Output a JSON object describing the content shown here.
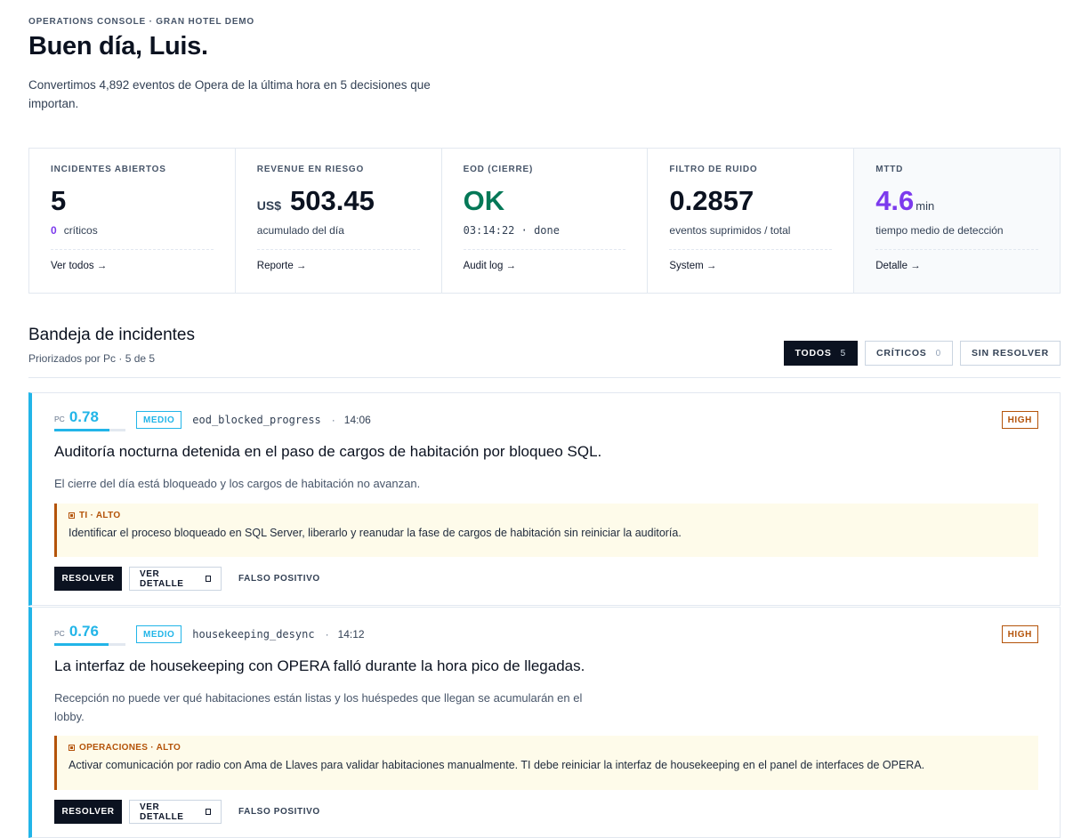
{
  "header": {
    "eyebrow": "OPERATIONS CONSOLE · GRAN HOTEL DEMO",
    "greeting": "Buen día, Luis.",
    "subtitle": "Convertimos 4,892 eventos de Opera de la última hora en 5 decisiones que importan."
  },
  "kpis": [
    {
      "label": "INCIDENTES ABIERTOS",
      "value": "5",
      "sub_prefix": "0",
      "sub": "críticos",
      "link": "Ver todos →"
    },
    {
      "label": "REVENUE EN RIESGO",
      "prefix": "US$",
      "value": "503.45",
      "sub": "acumulado del día",
      "link": "Reporte →"
    },
    {
      "label": "EOD (CIERRE)",
      "value": "OK",
      "sub": "03:14:22 · done",
      "link": "Audit log →"
    },
    {
      "label": "FILTRO DE RUIDO",
      "value": "0.2857",
      "sub": "eventos suprimidos / total",
      "link": "System →"
    },
    {
      "label": "MTTD",
      "value": "4.6",
      "unit": "min",
      "sub": "tiempo medio de detección",
      "link": "Detalle →"
    }
  ],
  "colors": {
    "accent_cyan": "#22b5e8",
    "accent_purple": "#7c3aed",
    "ok_green": "#047857",
    "high_amber": "#b45309",
    "dark": "#0b1220"
  },
  "inbox": {
    "title": "Bandeja de incidentes",
    "subtitle": "Priorizados por Pc · 5 de 5",
    "filters": [
      {
        "label": "TODOS",
        "count": "5",
        "active": true
      },
      {
        "label": "CRÍTICOS",
        "count": "0",
        "active": false
      },
      {
        "label": "SIN RESOLVER",
        "count": "",
        "active": false
      }
    ]
  },
  "incidents": [
    {
      "pc_label": "PC",
      "pc": "0.78",
      "pc_fraction": 0.78,
      "severity": "MEDIO",
      "code": "eod_blocked_progress",
      "separator": "·",
      "time": "14:06",
      "priority": "HIGH",
      "title": "Auditoría nocturna detenida en el paso de cargos de habitación por bloqueo SQL.",
      "description": "El cierre del día está bloqueado y los cargos de habitación no avanzan.",
      "action_tag": "TI · ALTO",
      "action_text": "Identificar el proceso bloqueado en SQL Server, liberarlo y reanudar la fase de cargos de habitación sin reiniciar la auditoría.",
      "btn_resolve": "RESOLVER",
      "btn_detail": "VER DETALLE",
      "btn_false": "FALSO POSITIVO"
    },
    {
      "pc_label": "PC",
      "pc": "0.76",
      "pc_fraction": 0.76,
      "severity": "MEDIO",
      "code": "housekeeping_desync",
      "separator": "·",
      "time": "14:12",
      "priority": "HIGH",
      "title": "La interfaz de housekeeping con OPERA falló durante la hora pico de llegadas.",
      "description": "Recepción no puede ver qué habitaciones están listas y los huéspedes que llegan se acumularán en el lobby.",
      "action_tag": "OPERACIONES · ALTO",
      "action_text": "Activar comunicación por radio con Ama de Llaves para validar habitaciones manualmente. TI debe reiniciar la interfaz de housekeeping en el panel de interfaces de OPERA.",
      "btn_resolve": "RESOLVER",
      "btn_detail": "VER DETALLE",
      "btn_false": "FALSO POSITIVO"
    }
  ]
}
